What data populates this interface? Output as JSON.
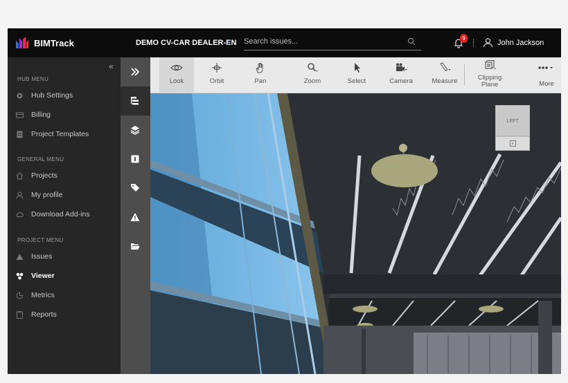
{
  "app": {
    "brand": "BIMTrack",
    "project": "DEMO CV-CAR DEALER-EN"
  },
  "search": {
    "placeholder": "Search issues..."
  },
  "notifications": {
    "count": "9"
  },
  "user": {
    "name": "John Jackson"
  },
  "menu": {
    "hub_title": "HUB MENU",
    "hub_items": [
      {
        "label": "Hub Settings",
        "icon": "gear-icon"
      },
      {
        "label": "Billing",
        "icon": "card-icon"
      },
      {
        "label": "Project Templates",
        "icon": "document-icon"
      }
    ],
    "general_title": "GENERAL MENU",
    "general_items": [
      {
        "label": "Projects",
        "icon": "home-icon"
      },
      {
        "label": "My profile",
        "icon": "user-icon"
      },
      {
        "label": "Download Add-ins",
        "icon": "cloud-icon"
      }
    ],
    "project_title": "PROJECT MENU",
    "project_items": [
      {
        "label": "Issues",
        "icon": "warning-icon"
      },
      {
        "label": "Viewer",
        "icon": "viewer-icon",
        "active": true
      },
      {
        "label": "Metrics",
        "icon": "metrics-icon"
      },
      {
        "label": "Reports",
        "icon": "reports-icon"
      }
    ]
  },
  "rail": [
    "expand-icon",
    "tree-icon",
    "layers-icon",
    "properties-icon",
    "tag-icon",
    "warning-icon",
    "folder-icon"
  ],
  "toolbar": {
    "look": "Look",
    "orbit": "Orbit",
    "pan": "Pan",
    "zoom": "Zoom",
    "select": "Select",
    "camera": "Camera",
    "measure": "Measure",
    "clipping_line1": "Clipping",
    "clipping_line2": "Plane",
    "more": "More"
  },
  "navcube": {
    "face": "LEFT"
  },
  "colors": {
    "header": "#0c0c0c",
    "menu": "#262626",
    "rail": "#4d4d4d",
    "toolbar": "#e9e9e9",
    "accent": "#3d8be0",
    "badge": "#e02020"
  }
}
